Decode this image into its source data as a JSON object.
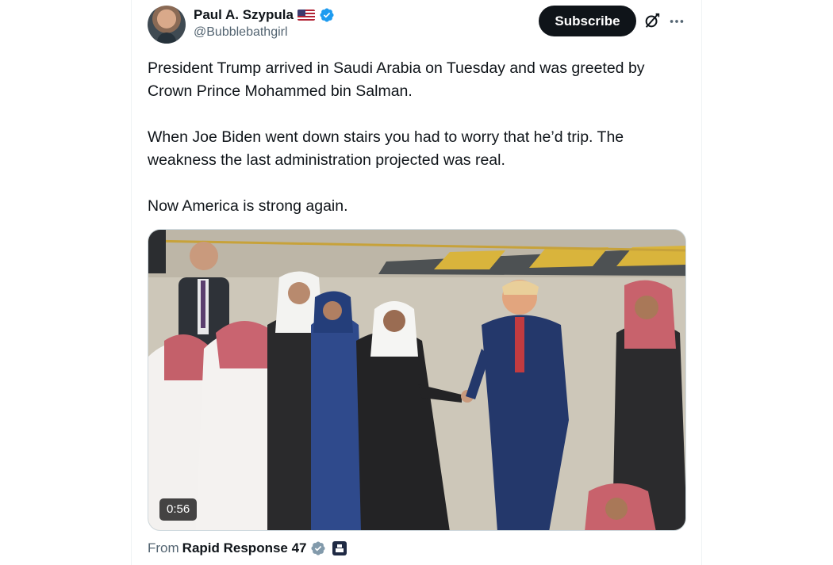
{
  "author": {
    "display_name": "Paul A. Szypula",
    "handle": "@Bubblebathgirl",
    "flag": "us-flag-icon",
    "verified": "blue-verified-badge-icon"
  },
  "actions": {
    "subscribe_label": "Subscribe",
    "grok_icon": "grok-icon",
    "more_icon": "more-options-icon"
  },
  "tweet": {
    "paragraphs": [
      "President Trump arrived in Saudi Arabia on Tuesday and was greeted by Crown Prince Mohammed bin Salman.",
      "When Joe Biden went down stairs you had to worry that he’d trip. The weakness the last administration projected was real.",
      "Now America is strong again."
    ]
  },
  "media": {
    "type": "video",
    "duration": "0:56"
  },
  "source": {
    "from_label": "From",
    "name": "Rapid Response 47",
    "badge": "gray-verified-badge-icon",
    "affiliate_icon": "affiliate-badge-icon"
  },
  "colors": {
    "text_primary": "#0f1419",
    "text_secondary": "#536471",
    "verified_blue": "#1d9bf0",
    "button_bg": "#0f1419"
  }
}
